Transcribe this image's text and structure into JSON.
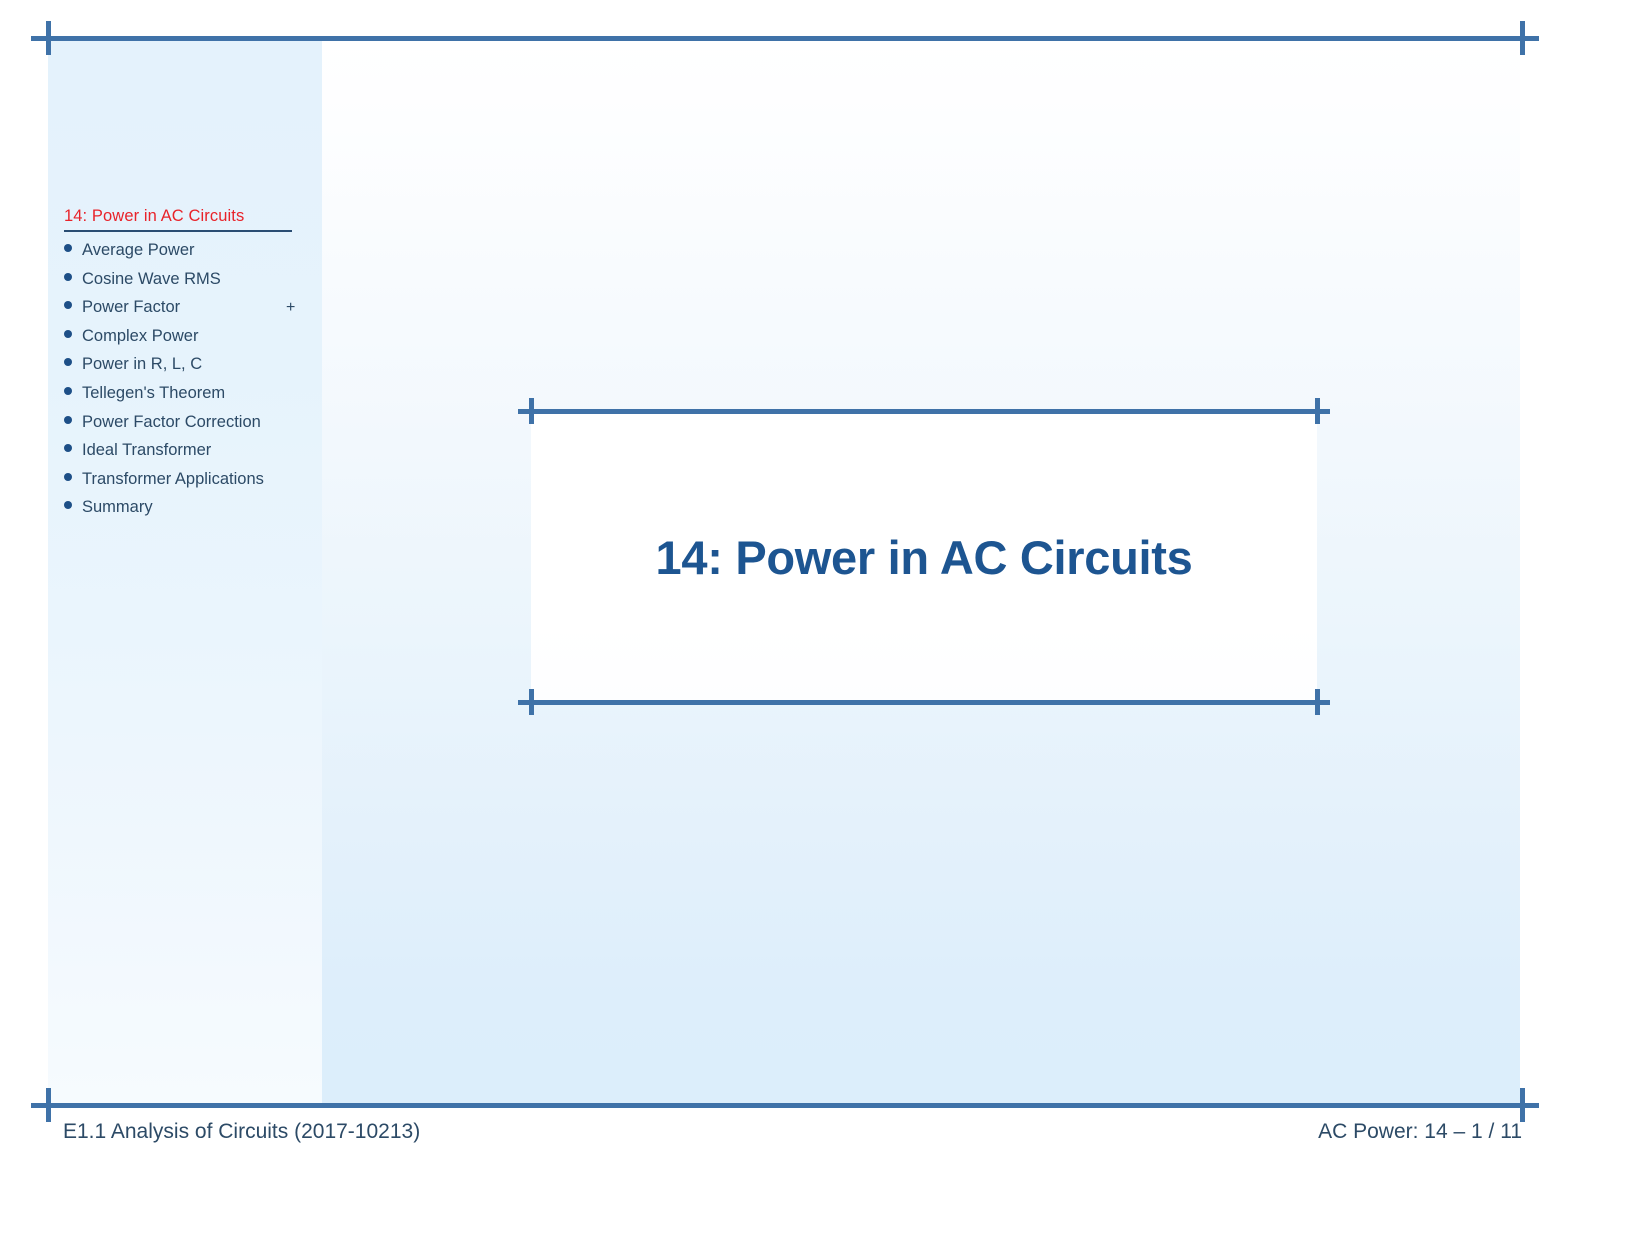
{
  "sidebar": {
    "heading": "14: Power in AC Circuits",
    "plus_marker": "+",
    "items": [
      {
        "label": "Average Power"
      },
      {
        "label": "Cosine Wave RMS"
      },
      {
        "label": "Power Factor"
      },
      {
        "label": "Complex Power"
      },
      {
        "label": "Power in R, L, C"
      },
      {
        "label": "Tellegen's Theorem"
      },
      {
        "label": "Power Factor Correction"
      },
      {
        "label": "Ideal Transformer"
      },
      {
        "label": "Transformer Applications"
      },
      {
        "label": "Summary"
      }
    ]
  },
  "main": {
    "title": "14: Power in AC Circuits"
  },
  "footer": {
    "left": "E1.1 Analysis of Circuits (2017-10213)",
    "right": "AC Power: 14 – 1 / 11"
  },
  "colors": {
    "accent_rule": "#3f72a8",
    "heading_red": "#e8232a",
    "title_blue": "#1d5591",
    "nav_text": "#2c4a66",
    "bullet": "#1d4f87",
    "sidebar_bg": "#e4f2fc"
  }
}
